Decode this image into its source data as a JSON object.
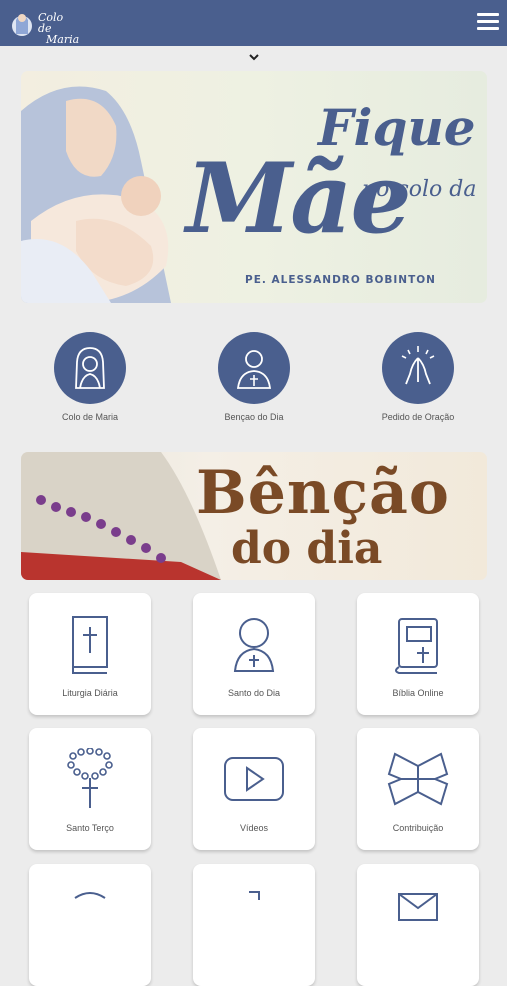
{
  "header": {
    "logo_text_line1": "Colo de",
    "logo_text_line2": "Maria"
  },
  "banner_main": {
    "title_small": "Fique",
    "title_big": "Mãe",
    "subtitle": "no colo da",
    "author": "PE. ALESSANDRO BOBINTON"
  },
  "quick_links": [
    {
      "label": "Colo de Maria",
      "icon": "mary-icon"
    },
    {
      "label": "Bençao do Dia",
      "icon": "priest-icon"
    },
    {
      "label": "Pedido de Oração",
      "icon": "praying-hands-icon"
    }
  ],
  "banner_blessing": {
    "line1": "Bênção",
    "line2": "do dia"
  },
  "grid": [
    {
      "label": "Liturgia Diária",
      "icon": "bible-icon"
    },
    {
      "label": "Santo do Dia",
      "icon": "saint-icon"
    },
    {
      "label": "Bíblia Online",
      "icon": "online-bible-icon"
    },
    {
      "label": "Santo Terço",
      "icon": "rosary-icon"
    },
    {
      "label": "Vídeos",
      "icon": "video-play-icon"
    },
    {
      "label": "Contribuição",
      "icon": "gift-icon"
    }
  ],
  "colors": {
    "primary": "#4a5f8e",
    "background": "#ececec",
    "card": "#ffffff",
    "blessing_text": "#7a4a26"
  }
}
